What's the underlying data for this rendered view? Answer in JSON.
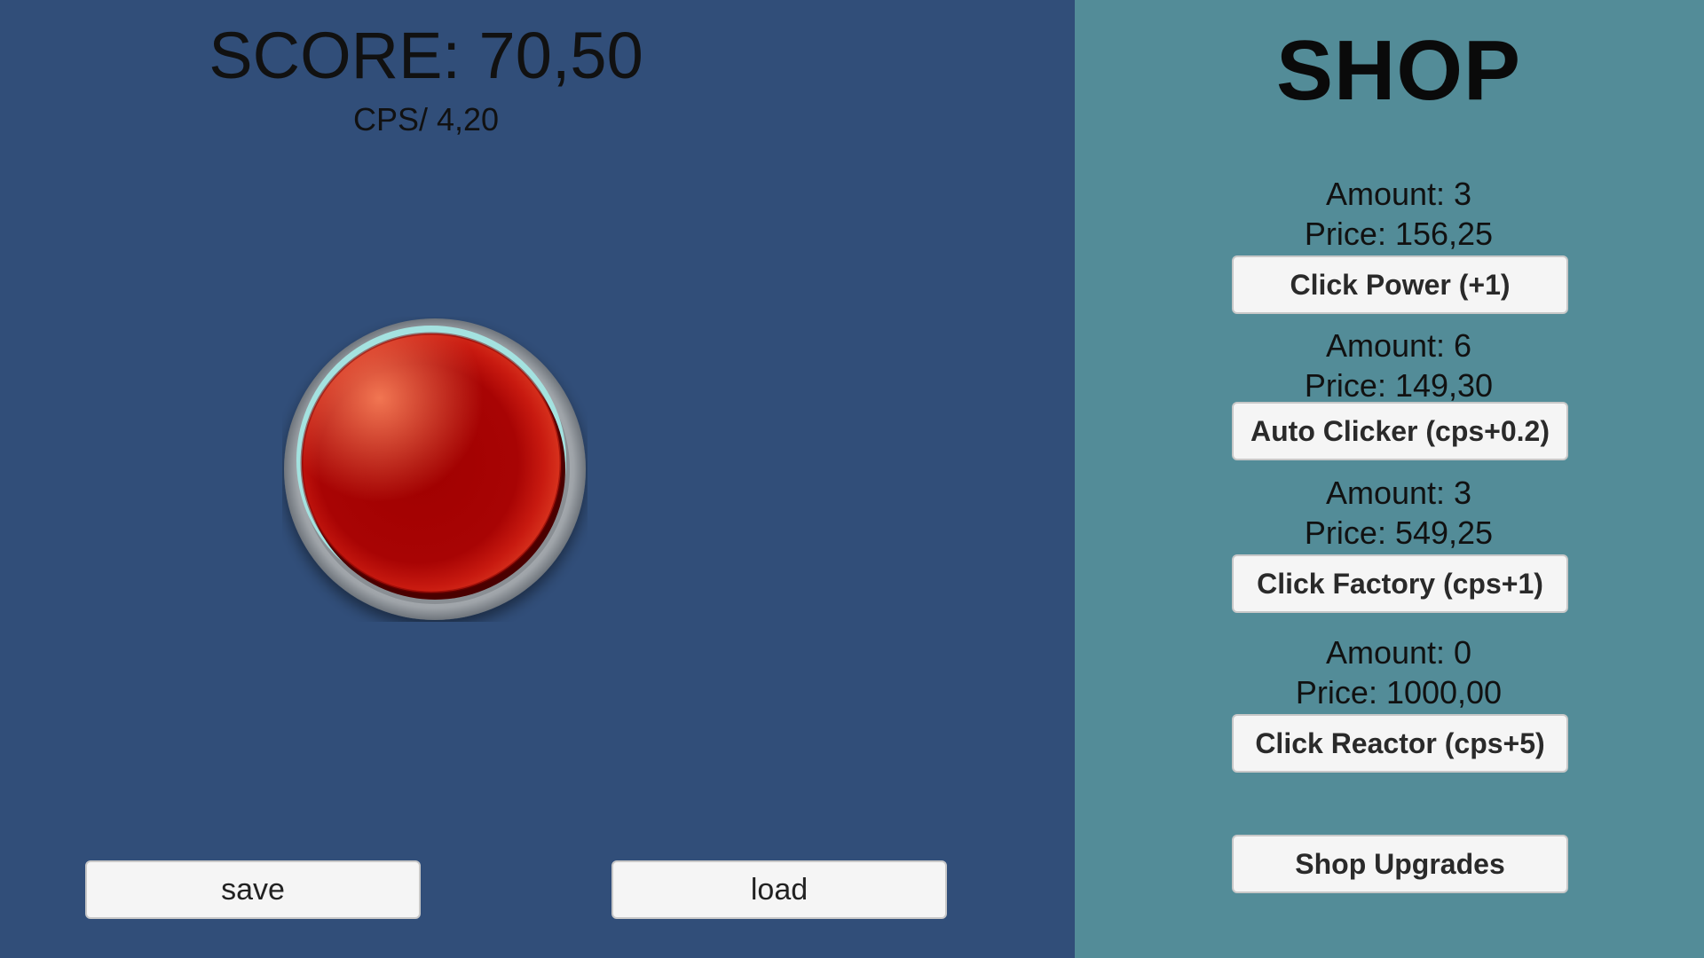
{
  "game": {
    "score_text": "SCORE: 70,50",
    "cps_text": "CPS/ 4,20",
    "big_button": "red-click-button",
    "save_label": "save",
    "load_label": "load"
  },
  "shop": {
    "title": "SHOP",
    "items": [
      {
        "amount": "Amount: 3",
        "price": "Price: 156,25",
        "button": "Click Power (+1)"
      },
      {
        "amount": "Amount: 6",
        "price": "Price: 149,30",
        "button": "Auto Clicker (cps+0.2)"
      },
      {
        "amount": "Amount: 3",
        "price": "Price: 549,25",
        "button": "Click Factory (cps+1)"
      },
      {
        "amount": "Amount: 0",
        "price": "Price: 1000,00",
        "button": "Click Reactor (cps+5)"
      }
    ],
    "upgrades_label": "Shop Upgrades"
  },
  "colors": {
    "left_bg": "#314e79",
    "right_bg": "#538c98",
    "button_red": "#a20000",
    "button_bg": "#f5f5f5"
  }
}
